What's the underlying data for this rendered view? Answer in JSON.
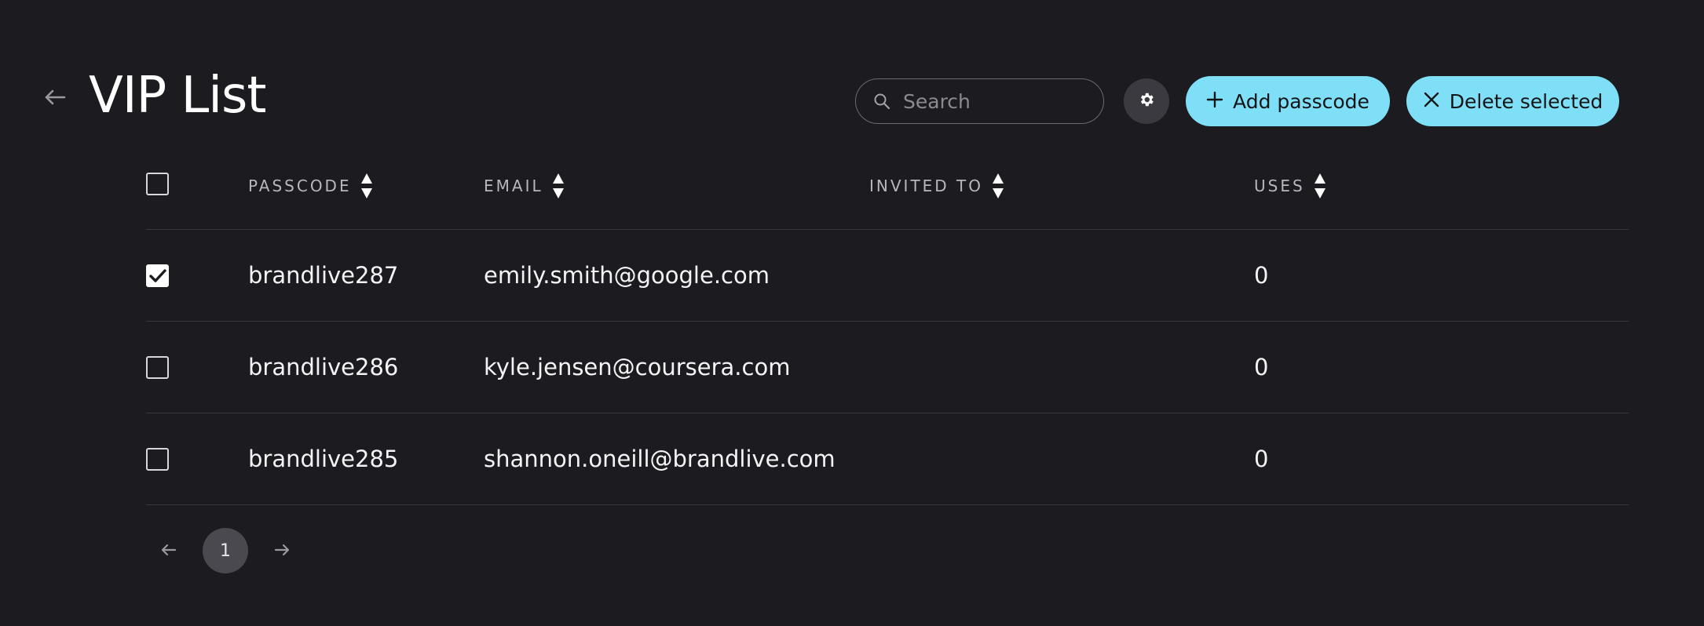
{
  "header": {
    "title": "VIP List",
    "back_icon": "arrow-left-icon"
  },
  "toolbar": {
    "search_placeholder": "Search",
    "search_value": "",
    "search_icon": "search-icon",
    "settings_icon": "gear-icon",
    "add_label": "Add passcode",
    "add_icon": "plus-icon",
    "delete_label": "Delete selected",
    "delete_icon": "close-icon",
    "accent_color": "#7edff6"
  },
  "table": {
    "columns": [
      {
        "label": "PASSCODE",
        "sortable": true
      },
      {
        "label": "EMAIL",
        "sortable": true
      },
      {
        "label": "INVITED TO",
        "sortable": true
      },
      {
        "label": "USES",
        "sortable": true
      }
    ],
    "select_all_checked": false,
    "rows": [
      {
        "checked": true,
        "passcode": "brandlive287",
        "email": "emily.smith@google.com",
        "invited_to": "",
        "uses": "0"
      },
      {
        "checked": false,
        "passcode": "brandlive286",
        "email": "kyle.jensen@coursera.com",
        "invited_to": "",
        "uses": "0"
      },
      {
        "checked": false,
        "passcode": "brandlive285",
        "email": "shannon.oneill@brandlive.com",
        "invited_to": "",
        "uses": "0"
      }
    ]
  },
  "pagination": {
    "current_page": "1",
    "prev_icon": "arrow-left-icon",
    "next_icon": "arrow-right-icon"
  }
}
